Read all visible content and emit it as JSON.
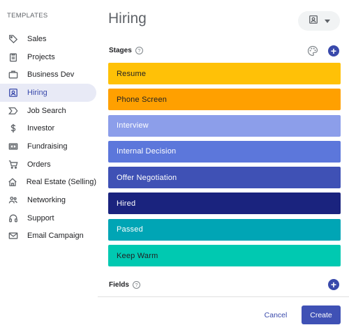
{
  "sidebar": {
    "heading": "TEMPLATES",
    "items": [
      {
        "label": "Sales",
        "icon": "tag-icon"
      },
      {
        "label": "Projects",
        "icon": "clipboard-icon"
      },
      {
        "label": "Business Dev",
        "icon": "briefcase-icon"
      },
      {
        "label": "Hiring",
        "icon": "badge-icon",
        "active": true
      },
      {
        "label": "Job Search",
        "icon": "chevron-flag-icon"
      },
      {
        "label": "Investor",
        "icon": "dollar-icon"
      },
      {
        "label": "Fundraising",
        "icon": "banknote-icon"
      },
      {
        "label": "Orders",
        "icon": "cart-icon"
      },
      {
        "label": "Real Estate (Selling)",
        "icon": "home-icon"
      },
      {
        "label": "Networking",
        "icon": "people-icon"
      },
      {
        "label": "Support",
        "icon": "headset-icon"
      },
      {
        "label": "Email Campaign",
        "icon": "mail-icon"
      }
    ]
  },
  "main": {
    "title": "Hiring",
    "icon_selector": {
      "icon": "badge-icon",
      "dropdown": "caret-down-icon"
    },
    "stages_label": "Stages",
    "help_glyph": "?",
    "add_glyph": "+",
    "stages": [
      {
        "label": "Resume",
        "color": "#FFC107",
        "text_color": "#202124"
      },
      {
        "label": "Phone Screen",
        "color": "#FFA000",
        "text_color": "#202124"
      },
      {
        "label": "Interview",
        "color": "#8C9EEA",
        "text_color": "#ffffff"
      },
      {
        "label": "Internal Decision",
        "color": "#5C77DB",
        "text_color": "#ffffff"
      },
      {
        "label": "Offer Negotiation",
        "color": "#3F51B5",
        "text_color": "#ffffff"
      },
      {
        "label": "Hired",
        "color": "#1A237E",
        "text_color": "#ffffff"
      },
      {
        "label": "Passed",
        "color": "#00A5B5",
        "text_color": "#ffffff"
      },
      {
        "label": "Keep Warm",
        "color": "#00C9B1",
        "text_color": "#202124"
      }
    ],
    "fields_label": "Fields"
  },
  "footer": {
    "cancel_label": "Cancel",
    "create_label": "Create"
  },
  "colors": {
    "accent": "#3F51B5",
    "active_bg": "#E8EAF6"
  }
}
